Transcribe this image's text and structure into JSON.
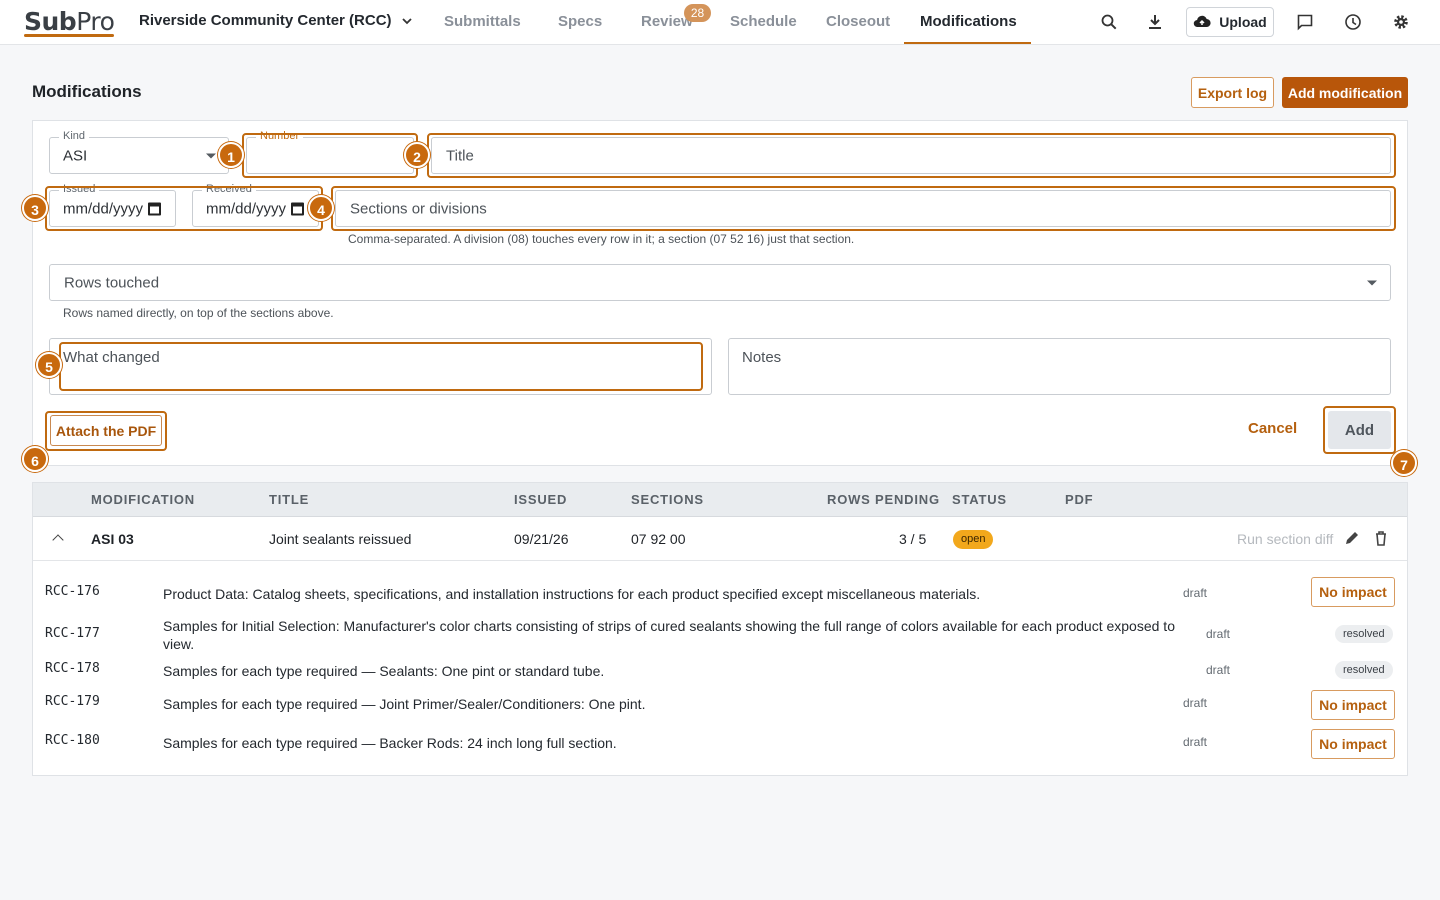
{
  "app": {
    "logo_main": "Sub",
    "logo_pro": "Pro"
  },
  "project": {
    "name": "Riverside Community Center (RCC)"
  },
  "nav": {
    "tabs": [
      "Submittals",
      "Specs",
      "Review",
      "Schedule",
      "Closeout",
      "Modifications"
    ],
    "review_badge": "28",
    "active": "Modifications"
  },
  "toolbar": {
    "upload_label": "Upload"
  },
  "page": {
    "title": "Modifications",
    "export_label": "Export log",
    "add_label": "Add modification"
  },
  "form": {
    "kind": {
      "label": "Kind",
      "value": "ASI"
    },
    "number": {
      "label": "Number",
      "value": ""
    },
    "title": {
      "placeholder": "Title"
    },
    "issued": {
      "label": "Issued",
      "value": "mm/dd/yyyy"
    },
    "received": {
      "label": "Received",
      "value": "mm/dd/yyyy"
    },
    "sections": {
      "placeholder": "Sections or divisions",
      "helper": "Comma-separated. A division (08) touches every row in it; a section (07 52 16) just that section."
    },
    "rows": {
      "placeholder": "Rows touched",
      "helper": "Rows named directly, on top of the sections above."
    },
    "what_changed": {
      "placeholder": "What changed"
    },
    "notes": {
      "placeholder": "Notes"
    },
    "attach_label": "Attach the PDF",
    "cancel_label": "Cancel",
    "add_label": "Add"
  },
  "markers": [
    "1",
    "2",
    "3",
    "4",
    "5",
    "6",
    "7"
  ],
  "table": {
    "headers": [
      "MODIFICATION",
      "TITLE",
      "ISSUED",
      "SECTIONS",
      "ROWS PENDING",
      "STATUS",
      "PDF"
    ],
    "main_row": {
      "modification": "ASI 03",
      "title": "Joint sealants reissued",
      "issued": "09/21/26",
      "sections": "07 92 00",
      "rows_pending": "3 / 5",
      "status": "open",
      "run_diff": "Run section diff"
    },
    "sub_rows": [
      {
        "code": "RCC-176",
        "desc": "Product Data: Catalog sheets, specifications, and installation instructions for each product specified except miscellaneous materials.",
        "state": "draft",
        "action": "No impact"
      },
      {
        "code": "RCC-177",
        "desc": "Samples for Initial Selection: Manufacturer's color charts consisting of strips of cured sealants showing the full range of colors available for each product exposed to view.",
        "state": "draft",
        "action": "resolved"
      },
      {
        "code": "RCC-178",
        "desc": "Samples for each type required — Sealants: One pint or standard tube.",
        "state": "draft",
        "action": "resolved"
      },
      {
        "code": "RCC-179",
        "desc": "Samples for each type required — Joint Primer/Sealer/Conditioners: One pint.",
        "state": "draft",
        "action": "No impact"
      },
      {
        "code": "RCC-180",
        "desc": "Samples for each type required — Backer Rods: 24 inch long full section.",
        "state": "draft",
        "action": "No impact"
      }
    ]
  },
  "colors": {
    "accent": "#c06a10",
    "primary": "#b8560a",
    "status_open": "#f2a81c"
  }
}
